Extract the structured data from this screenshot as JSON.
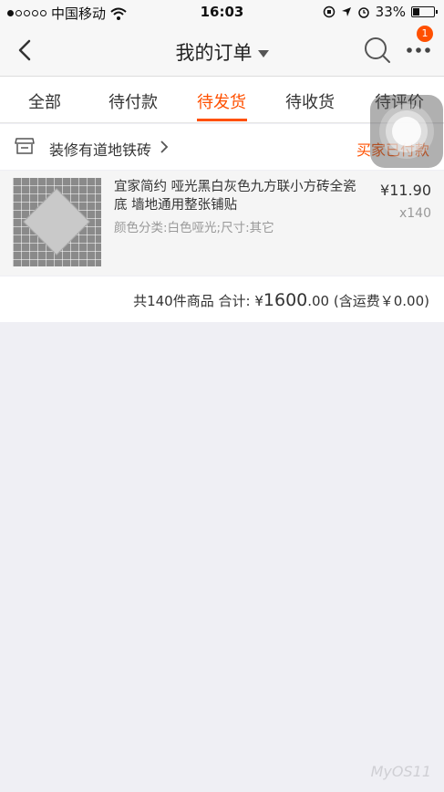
{
  "status_bar": {
    "carrier": "中国移动",
    "time": "16:03",
    "battery": "33%",
    "battery_level": 0.33,
    "signal_bars_filled": 1,
    "signal_bars_total": 5
  },
  "nav": {
    "title": "我的订单",
    "badge_count": "1"
  },
  "tabs": [
    {
      "label": "全部"
    },
    {
      "label": "待付款"
    },
    {
      "label": "待发货",
      "active": true
    },
    {
      "label": "待收货"
    },
    {
      "label": "待评价"
    }
  ],
  "order": {
    "shop_name": "装修有道地铁砖",
    "status": "买家已付款",
    "item": {
      "title": "宜家简约 哑光黑白灰色九方联小方砖全瓷底 墙地通用整张铺贴",
      "sku": "颜色分类:白色哑光;尺寸:其它",
      "price": "¥11.90",
      "quantity": "x140"
    },
    "summary": {
      "count_text": "共140件商品",
      "total_label": "合计:",
      "currency": "¥",
      "total_int": "1600",
      "total_dec": ".00",
      "shipping": "(含运费￥0.00)"
    }
  },
  "watermark": "MyOS11"
}
